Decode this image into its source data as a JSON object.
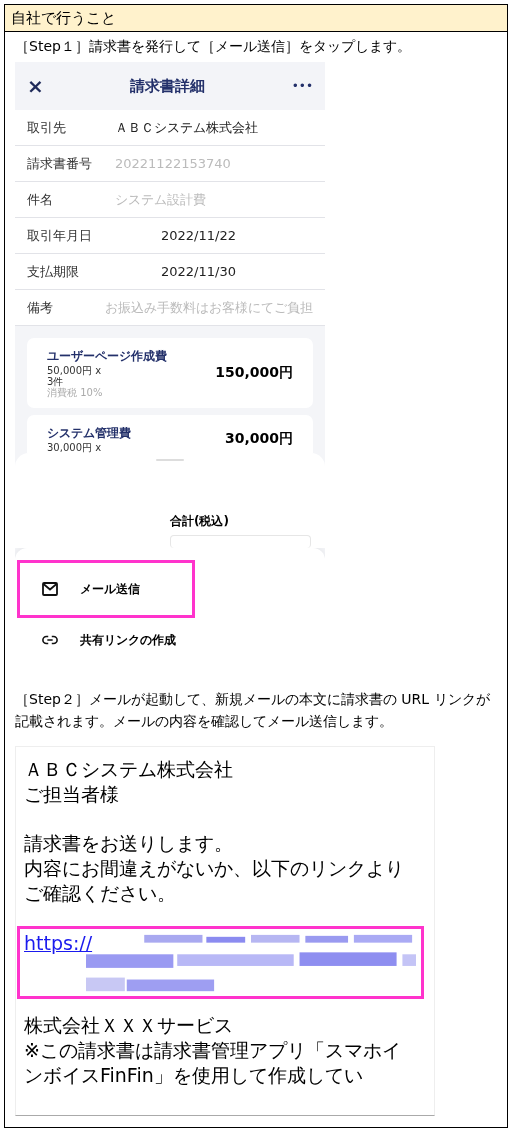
{
  "section_title": "自社で行うこと",
  "steps": [
    {
      "text": "［Step１］請求書を発行して［メール送信］をタップします。"
    },
    {
      "text": "［Step２］メールが起動して、新規メールの本文に請求書の URL リンクが記載されます。メールの内容を確認してメール送信します。"
    }
  ],
  "invoice_screen": {
    "close": "×",
    "title": "請求書詳細",
    "more": "•••",
    "fields": [
      {
        "label": "取引先",
        "value": "ＡＢＣシステム株式会社",
        "kind": "text"
      },
      {
        "label": "請求書番号",
        "placeholder": "20221122153740",
        "kind": "text"
      },
      {
        "label": "件名",
        "placeholder": "システム設計費",
        "kind": "text"
      },
      {
        "label": "取引年月日",
        "value": "2022/11/22",
        "kind": "date"
      },
      {
        "label": "支払期限",
        "value": "2022/11/30",
        "kind": "date"
      },
      {
        "label": "備考",
        "placeholder": "お振込み手数料はお客様にてご負担",
        "kind": "text"
      }
    ],
    "items": [
      {
        "name": "ユーザーページ作成費",
        "unit": "50,000円 x",
        "qty": "3件",
        "tax": "消費税 10%",
        "amount": "150,000円"
      },
      {
        "name": "システム管理費",
        "unit": "30,000円 x",
        "amount": "30,000円"
      }
    ],
    "total_label": "合計(税込)",
    "actions": [
      {
        "label": "メール送信",
        "kind": "mail",
        "highlighted": true
      },
      {
        "label": "共有リンクの作成",
        "kind": "link",
        "highlighted": false
      }
    ]
  },
  "email_screen": {
    "lines": [
      "ＡＢＣシステム株式会社",
      "ご担当者様"
    ],
    "body": [
      "請求書をお送りします。",
      "内容にお間違えがないか、以下のリンクよりご確認ください。"
    ],
    "link": {
      "text": "https://",
      "highlighted": true
    },
    "signature": [
      "株式会社ＸＸＸサービス",
      "※この請求書は請求書管理アプリ「スマホインボイスFinFin」を使用して作成してい"
    ]
  }
}
